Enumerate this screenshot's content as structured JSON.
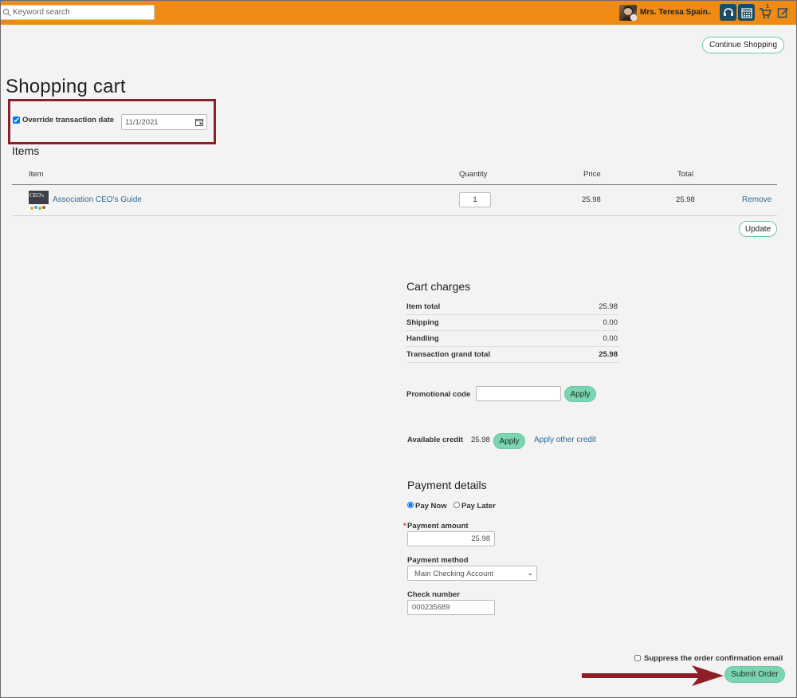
{
  "header": {
    "search_placeholder": "Keyword search",
    "user_name": "Mrs. Teresa Spain",
    "cart_count": "1",
    "bar_color": "#ef8a12",
    "icon_color": "#1d4b63"
  },
  "continue_shopping_label": "Continue Shopping",
  "page_title": "Shopping cart",
  "override": {
    "label": "Override transaction date",
    "date_value": "11/1/2021",
    "checked": true
  },
  "items_section": {
    "title": "Items",
    "columns": {
      "item": "Item",
      "quantity": "Quantity",
      "price": "Price",
      "total": "Total"
    },
    "rows": [
      {
        "thumb_text": "CEO's",
        "name": "Association CEO's Guide",
        "quantity": "1",
        "price": "25.98",
        "total": "25.98",
        "remove_label": "Remove"
      }
    ],
    "update_label": "Update"
  },
  "cart_charges": {
    "title": "Cart charges",
    "rows": [
      {
        "label": "Item total",
        "value": "25.98"
      },
      {
        "label": "Shipping",
        "value": "0.00"
      },
      {
        "label": "Handling",
        "value": "0.00"
      },
      {
        "label": "Transaction grand total",
        "value": "25.98"
      }
    ]
  },
  "promo": {
    "label": "Promotional code",
    "value": "",
    "apply_label": "Apply"
  },
  "credit": {
    "label": "Available credit",
    "amount": "25.98",
    "apply_label": "Apply",
    "other_label": "Apply other credit"
  },
  "payment": {
    "title": "Payment details",
    "options": [
      "Pay Now",
      "Pay Later"
    ],
    "selected": "Pay Now",
    "required_mark": "*",
    "amount_label": "Payment amount",
    "amount_value": "25.98",
    "method_label": "Payment method",
    "method_value": "Main Checking Account",
    "check_label": "Check number",
    "check_value": "000235689"
  },
  "suppress_label": "Suppress the order confirmation email",
  "submit_label": "Submit Order",
  "accent_colors": {
    "button_green": "#7bd5b0",
    "link_blue": "#2f6a94",
    "highlight_red": "#8e1f27"
  }
}
